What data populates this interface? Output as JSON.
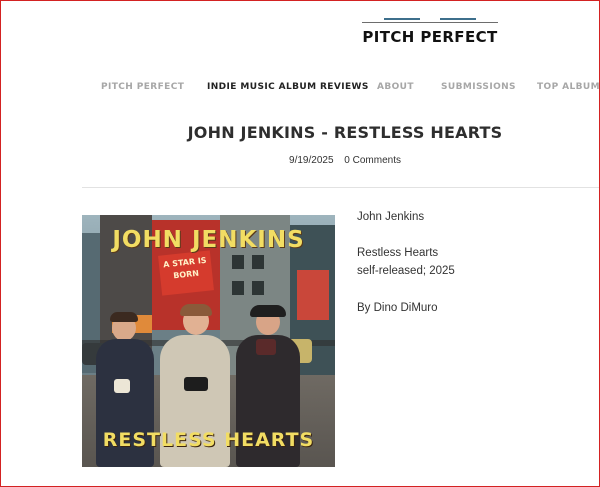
{
  "logo": {
    "text": "PITCH PERFECT"
  },
  "nav": {
    "items": [
      {
        "label": "PITCH PERFECT",
        "active": false
      },
      {
        "label": "INDIE MUSIC ALBUM REVIEWS",
        "active": true
      },
      {
        "label": "ABOUT",
        "active": false
      },
      {
        "label": "SUBMISSIONS",
        "active": false
      },
      {
        "label": "TOP ALBUMS",
        "active": false
      }
    ]
  },
  "post": {
    "title": "JOHN JENKINS - RESTLESS HEARTS",
    "date": "9/19/2025",
    "comments": "0 Comments"
  },
  "album": {
    "artist_text": "JOHN JENKINS",
    "title_text": "RESTLESS HEARTS",
    "sign_text": "A STAR IS BORN"
  },
  "details": {
    "artist": "John Jenkins",
    "album": "Restless Hearts",
    "release": "self-released; 2025",
    "byline": "By Dino DiMuro"
  },
  "colors": {
    "frame": "#d32222",
    "nav_inactive": "#a7a7a7",
    "nav_active": "#222222",
    "album_text": "#f2dd63",
    "logo_accent": "#3d6f8c"
  }
}
